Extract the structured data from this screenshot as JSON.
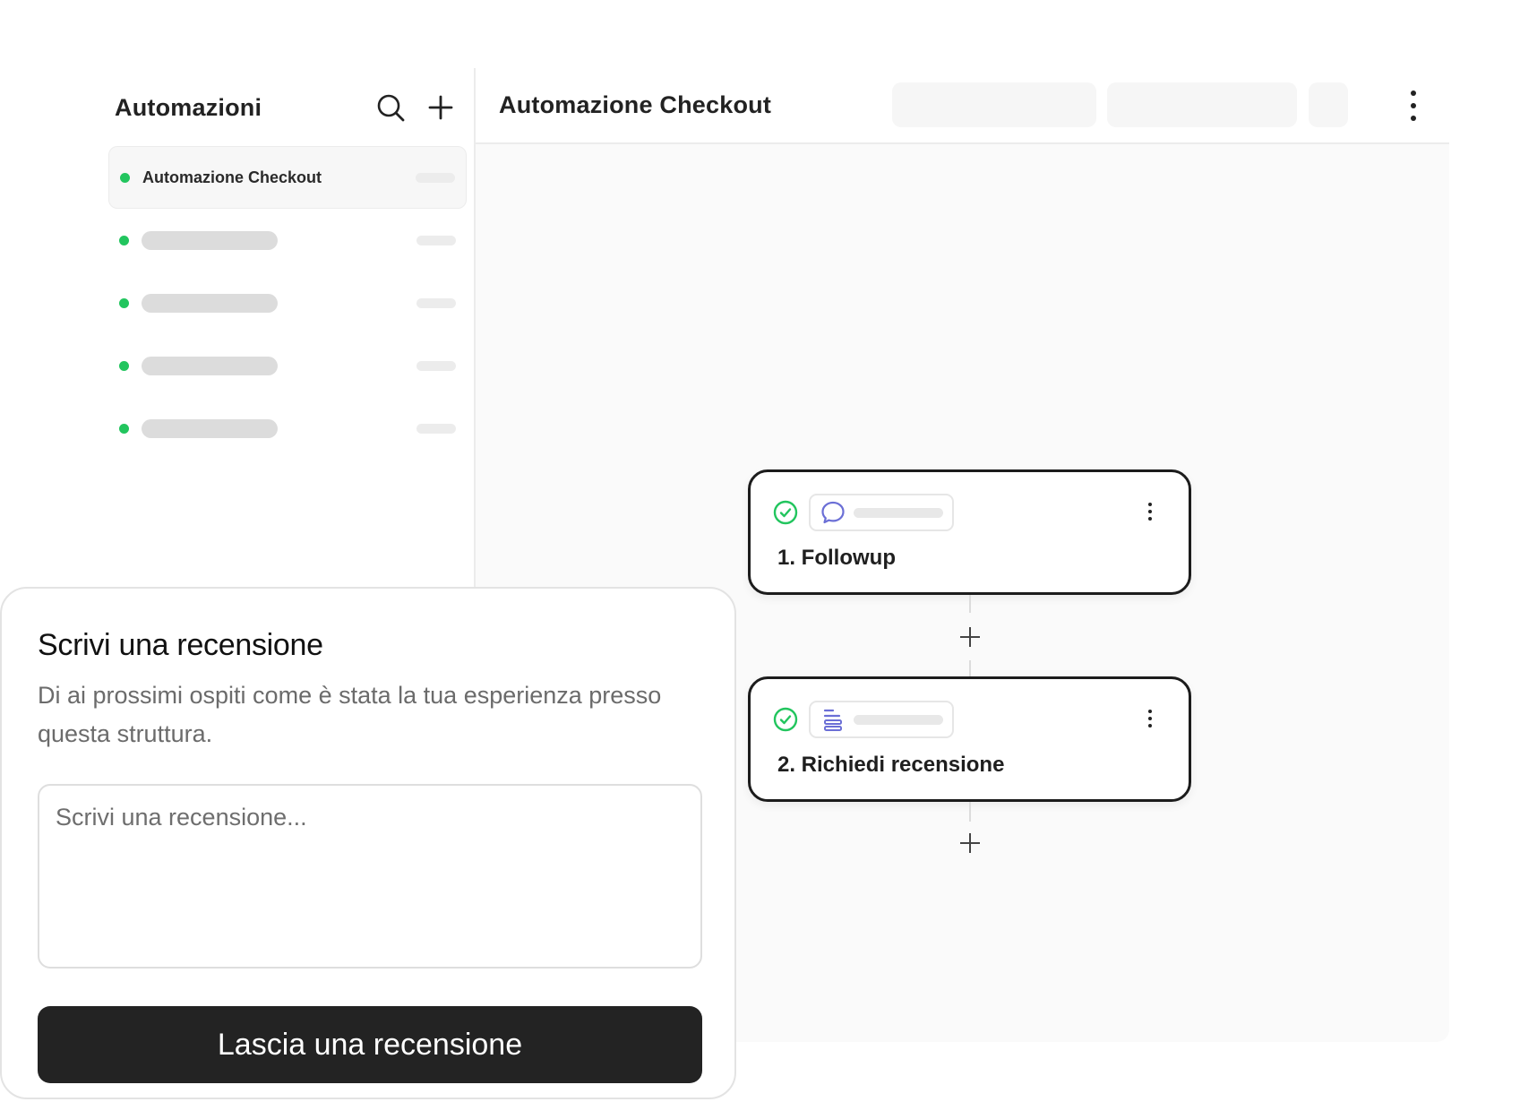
{
  "colors": {
    "status_active": "#22c55e",
    "node_border": "#1c1c1c",
    "chip_icon": "#6b6fd6",
    "button_bg": "#232323"
  },
  "sidebar": {
    "title": "Automazioni",
    "icons": [
      "search-icon",
      "plus-icon"
    ],
    "items": [
      {
        "label": "Automazione Checkout",
        "status": "active"
      },
      {
        "label": "",
        "status": "active"
      },
      {
        "label": "",
        "status": "active"
      },
      {
        "label": "",
        "status": "active"
      },
      {
        "label": "",
        "status": "active"
      }
    ]
  },
  "main": {
    "title": "Automazione Checkout",
    "menu_icon": "more-vertical-icon"
  },
  "flow": {
    "steps": [
      {
        "label": "1. Followup",
        "icon": "chat-bubble-icon",
        "status": "check-circle-icon"
      },
      {
        "label": "2. Richiedi recensione",
        "icon": "text-lines-icon",
        "status": "check-circle-icon"
      }
    ],
    "add_icon": "plus-icon"
  },
  "review": {
    "title": "Scrivi una recensione",
    "subtitle": "Di ai prossimi ospiti come è stata la tua esperienza presso questa struttura.",
    "placeholder": "Scrivi una recensione...",
    "button_label": "Lascia una recensione"
  }
}
